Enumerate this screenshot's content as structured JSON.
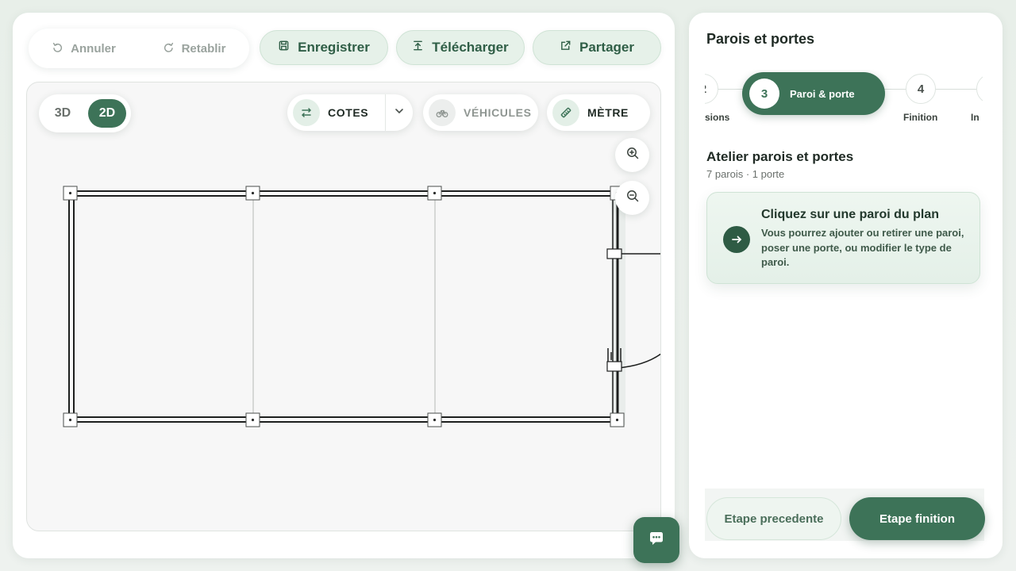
{
  "toolbar": {
    "undo_label": "Annuler",
    "redo_label": "Retablir",
    "save_label": "Enregistrer",
    "download_label": "Télécharger",
    "share_label": "Partager"
  },
  "canvas": {
    "view_3d_label": "3D",
    "view_2d_label": "2D",
    "active_view": "2D",
    "cotes_label": "COTES",
    "vehicles_label": "VÉHICULES",
    "metre_label": "MÈTRE"
  },
  "panel": {
    "title": "Parois et portes",
    "steps": [
      {
        "number": "2",
        "label": "sions"
      },
      {
        "number": "3",
        "label": "Paroi & porte",
        "active": true
      },
      {
        "number": "4",
        "label": "Finition"
      },
      {
        "number": "",
        "label": "In"
      }
    ],
    "section_title": "Atelier parois et portes",
    "section_subtitle": "7 parois · 1 porte",
    "info_title": "Cliquez sur une paroi du plan",
    "info_text": "Vous pourrez ajouter ou retirer une paroi, poser une porte, ou modifier le type de paroi.",
    "prev_label": "Etape precedente",
    "next_label": "Etape finition"
  },
  "colors": {
    "accent": "#3d7358",
    "accent_light": "#e6f1e9",
    "muted_text": "#9aa39e"
  },
  "icons": {
    "undo": "undo-icon",
    "redo": "redo-icon",
    "save": "floppy-icon",
    "download": "download-icon",
    "share": "external-link-icon",
    "cotes": "dimensions-icon",
    "vehicles": "bicycle-icon",
    "metre": "ruler-icon",
    "zoom_in": "zoom-in-icon",
    "zoom_out": "zoom-out-icon",
    "chat": "chat-icon",
    "info_arrow": "arrow-right-icon"
  }
}
